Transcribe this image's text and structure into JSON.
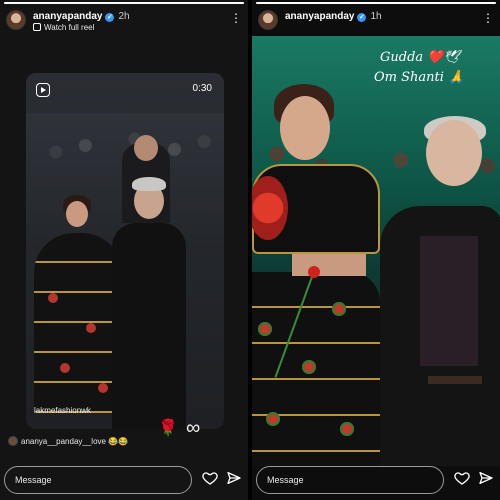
{
  "left_story": {
    "progress_percent": 100,
    "header": {
      "username": "ananyapanday",
      "time": "2h",
      "subline": "Watch full reel"
    },
    "reel": {
      "duration": "0:30",
      "watermark": "lakmefashionwk"
    },
    "mention": "ananya__panday__love 😂😂",
    "stickers": {
      "rose": "🌹",
      "infinity": "∞"
    },
    "message_placeholder": "Message"
  },
  "right_story": {
    "progress_percent": 100,
    "header": {
      "username": "ananyapanday",
      "time": "1h"
    },
    "caption_line1": "Gudda ❤️🕊",
    "caption_line2": "Om Shanti 🙏",
    "message_placeholder": "Message"
  },
  "icons": {
    "verified": "verified-badge-icon",
    "more": "kebab-menu-icon",
    "reel": "reel-icon",
    "heart": "heart-icon",
    "send": "send-icon"
  },
  "colors": {
    "verified_blue": "#3897f0",
    "background": "#000000"
  }
}
